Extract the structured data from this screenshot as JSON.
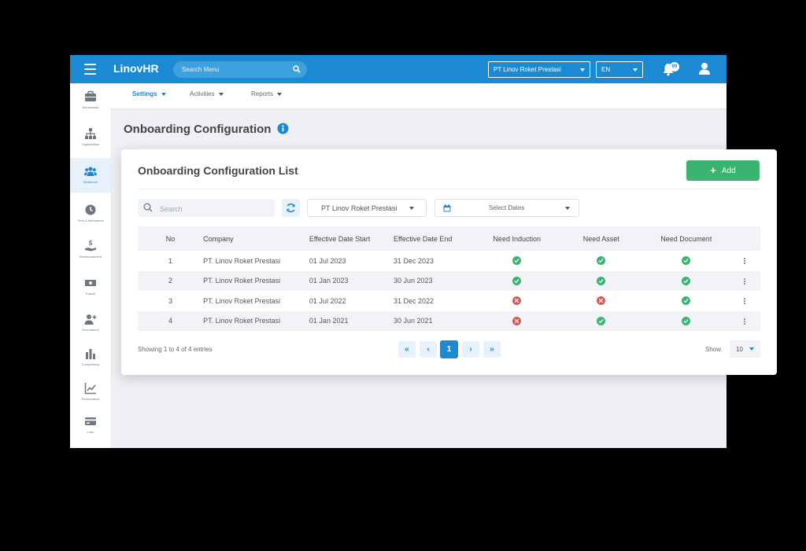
{
  "app": {
    "name": "LinovHR",
    "search_placeholder": "Search Menu",
    "company": "PT Linov Roket Prestasi",
    "language": "EN",
    "notification_count": "99",
    "brand_color": "#1b8ad3"
  },
  "sidebar": {
    "items": [
      {
        "label": "Worksheets",
        "icon": "briefcase-icon"
      },
      {
        "label": "Organization",
        "icon": "org-chart-icon"
      },
      {
        "label": "Workforce",
        "icon": "people-icon"
      },
      {
        "label": "Time & Attendance",
        "icon": "clock-icon"
      },
      {
        "label": "Reimbursement",
        "icon": "hand-money-icon"
      },
      {
        "label": "Payroll",
        "icon": "money-icon"
      },
      {
        "label": "Recruitment",
        "icon": "add-user-icon"
      },
      {
        "label": "Competency",
        "icon": "bar-chart-icon"
      },
      {
        "label": "Performance",
        "icon": "trend-chart-icon"
      },
      {
        "label": "Loan",
        "icon": "card-icon"
      }
    ],
    "active": "Workforce"
  },
  "subnav": {
    "tabs": [
      {
        "label": "Settings",
        "active": true
      },
      {
        "label": "Activities",
        "active": false
      },
      {
        "label": "Reports",
        "active": false
      }
    ]
  },
  "page": {
    "title": "Onboarding Configuration"
  },
  "card": {
    "title": "Onboarding Configuration List",
    "add_label": "Add",
    "search_placeholder": "Search",
    "company_filter": "PT Linov Roket Prestasi",
    "date_filter": "Select Dates"
  },
  "table": {
    "columns": [
      "No",
      "Company",
      "Effective Date Start",
      "Effective Date End",
      "Need Induction",
      "Need Asset",
      "Need Document"
    ],
    "rows": [
      {
        "no": "1",
        "company": "PT. Linov Roket Prestasi",
        "start": "01 Jul 2023",
        "end": "31 Dec 2023",
        "induction": true,
        "asset": true,
        "document": true
      },
      {
        "no": "2",
        "company": "PT. Linov Roket Prestasi",
        "start": "01 Jan 2023",
        "end": "30 Jun 2023",
        "induction": true,
        "asset": true,
        "document": true
      },
      {
        "no": "3",
        "company": "PT. Linov Roket Prestasi",
        "start": "01 Jul 2022",
        "end": "31 Dec 2022",
        "induction": false,
        "asset": false,
        "document": true
      },
      {
        "no": "4",
        "company": "PT. Linov Roket Prestasi",
        "start": "01 Jan 2021",
        "end": "30 Jun 2021",
        "induction": false,
        "asset": true,
        "document": true
      }
    ]
  },
  "footer": {
    "info": "Showing 1 to 4 of 4 entries",
    "current_page": "1",
    "show_label": "Show",
    "page_size": "10"
  },
  "colors": {
    "success": "#3cb371",
    "danger": "#e05656"
  }
}
